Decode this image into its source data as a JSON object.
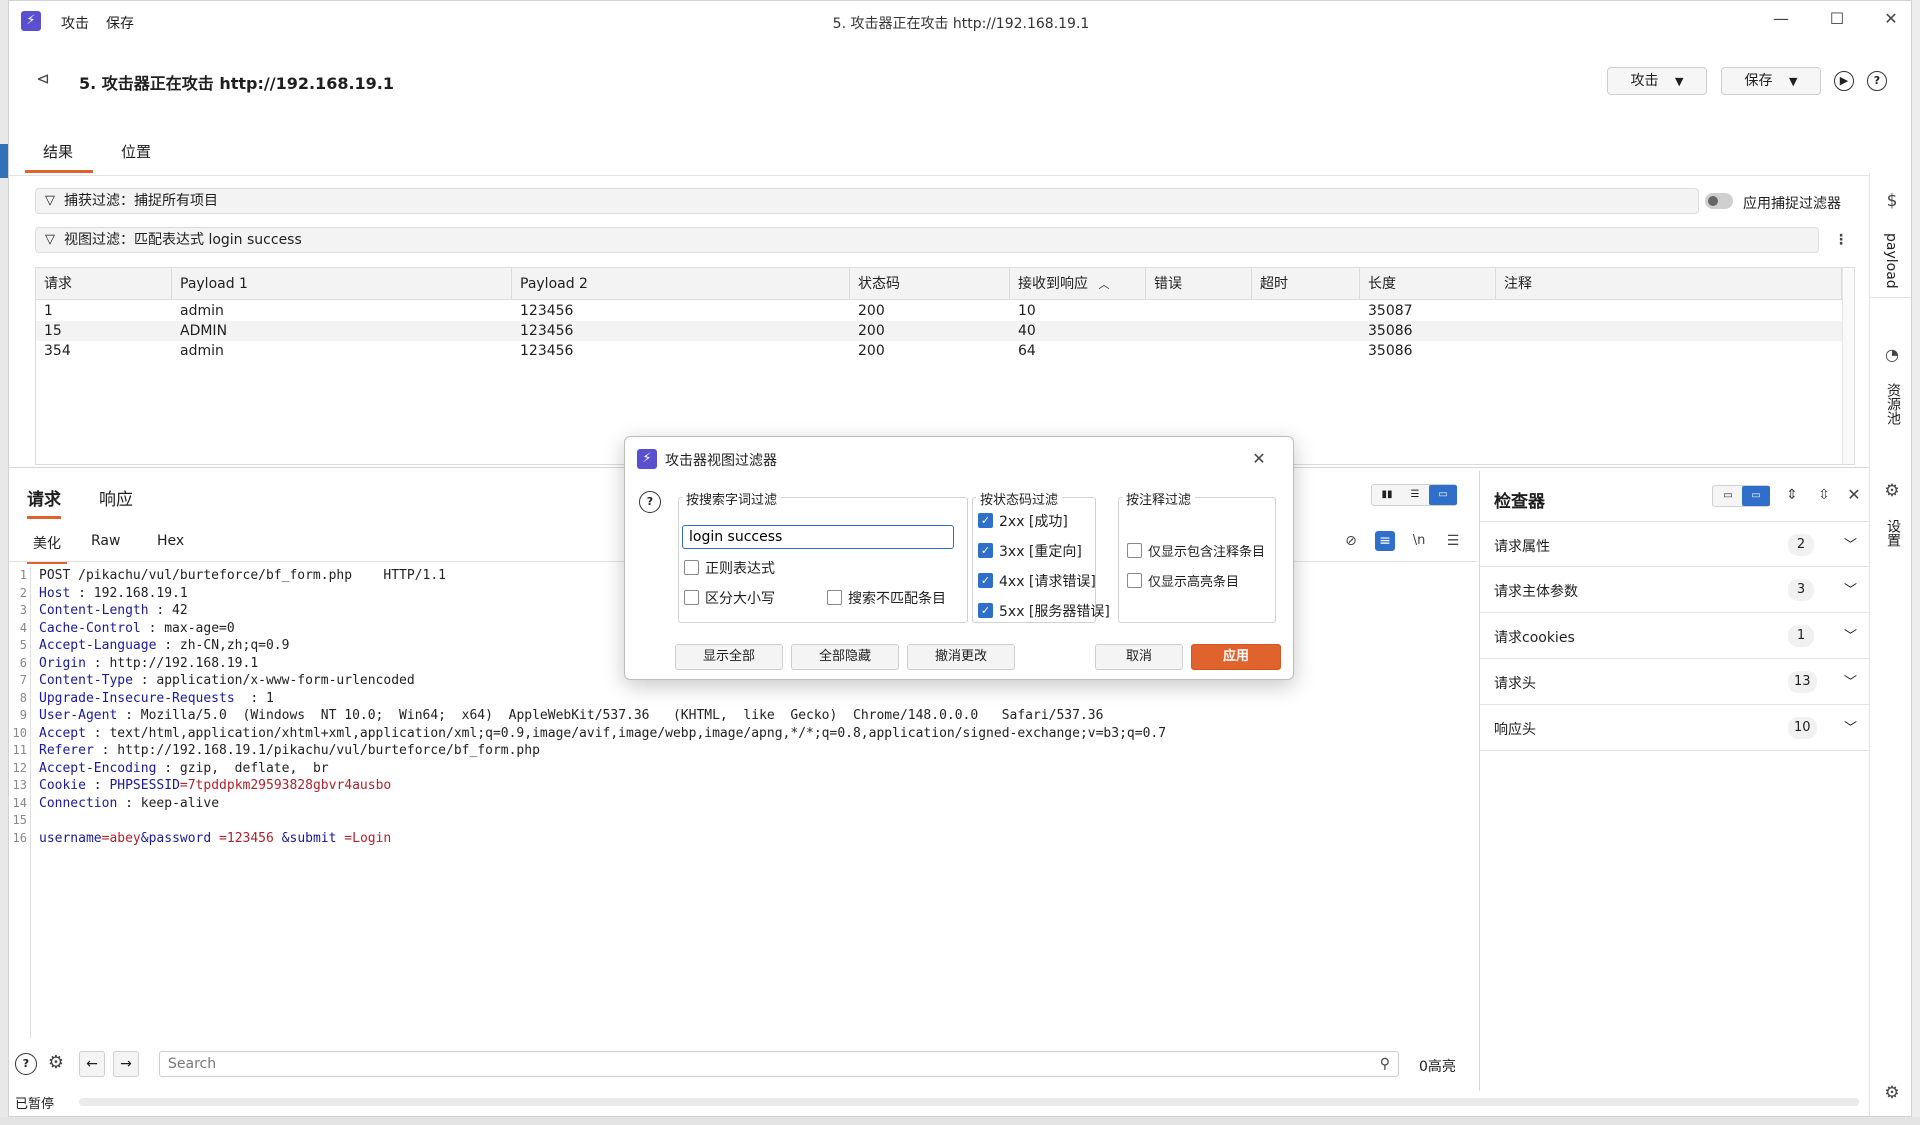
{
  "window": {
    "title": "5. 攻击器正在攻击 http://192.168.19.1",
    "menu": [
      "攻击",
      "保存"
    ]
  },
  "header": {
    "title": "5. 攻击器正在攻击 http://192.168.19.1",
    "attack_btn": "攻击",
    "save_btn": "保存"
  },
  "tabs": [
    "结果",
    "位置"
  ],
  "filters": {
    "capture": "捕获过滤：捕捉所有项目",
    "apply_capture": "应用捕捉过滤器",
    "view": "视图过滤：匹配表达式 login success"
  },
  "table": {
    "columns": [
      "请求",
      "Payload 1",
      "Payload 2",
      "状态码",
      "接收到响应",
      "错误",
      "超时",
      "长度",
      "注释"
    ],
    "rows": [
      [
        "1",
        "admin",
        "123456",
        "200",
        "10",
        "",
        "",
        "35087",
        ""
      ],
      [
        "15",
        "ADMIN",
        "123456",
        "200",
        "40",
        "",
        "",
        "35086",
        ""
      ],
      [
        "354",
        "admin",
        "123456",
        "200",
        "64",
        "",
        "",
        "35086",
        ""
      ]
    ]
  },
  "request_pane": {
    "tabs": [
      "请求",
      "响应"
    ],
    "subtabs": [
      "美化",
      "Raw",
      "Hex"
    ],
    "lines": [
      {
        "n": "1",
        "k": "",
        "v": "POST /pikachu/vul/burteforce/bf_form.php    HTTP/1.1"
      },
      {
        "n": "2",
        "k": "Host",
        "v": " : 192.168.19.1"
      },
      {
        "n": "3",
        "k": "Content-Length",
        "v": " : 42"
      },
      {
        "n": "4",
        "k": "Cache-Control",
        "v": " : max-age=0"
      },
      {
        "n": "5",
        "k": "Accept-Language",
        "v": " : zh-CN,zh;q=0.9"
      },
      {
        "n": "6",
        "k": "Origin",
        "v": " : http://192.168.19.1"
      },
      {
        "n": "7",
        "k": "Content-Type",
        "v": " : application/x-www-form-urlencoded"
      },
      {
        "n": "8",
        "k": "Upgrade-Insecure-Requests",
        "v": "  : 1"
      },
      {
        "n": "9",
        "k": "User-Agent",
        "v": " : Mozilla/5.0  (Windows  NT 10.0;  Win64;  x64)  AppleWebKit/537.36   (KHTML,  like  Gecko)  Chrome/148.0.0.0   Safari/537.36"
      },
      {
        "n": "10",
        "k": "Accept",
        "v": " : text/html,application/xhtml+xml,application/xml;q=0.9,image/avif,image/webp,image/apng,*/*;q=0.8,application/signed-exchange;v=b3;q=0.7"
      },
      {
        "n": "11",
        "k": "Referer",
        "v": " : http://192.168.19.1/pikachu/vul/burteforce/bf_form.php"
      },
      {
        "n": "12",
        "k": "Accept-Encoding",
        "v": " : gzip,  deflate,  br"
      },
      {
        "n": "13",
        "k": "Cookie",
        "v": " : ",
        "ck": "PHPSESSID",
        "cv": "=7tpddpkm29593828gbvr4ausbo"
      },
      {
        "n": "14",
        "k": "Connection",
        "v": " : keep-alive"
      },
      {
        "n": "15",
        "k": "",
        "v": ""
      },
      {
        "n": "16",
        "k": "",
        "v": ""
      }
    ],
    "body_line": {
      "k1": "username",
      "v1": "=abey",
      "k2": "&password",
      "v2": " =123456",
      "k3": " &submit",
      "v3": " =Login"
    },
    "search_placeholder": "Search",
    "highlight_count": "0高亮"
  },
  "inspector": {
    "title": "检查器",
    "rows": [
      {
        "label": "请求属性",
        "count": "2"
      },
      {
        "label": "请求主体参数",
        "count": "3"
      },
      {
        "label": "请求cookies",
        "count": "1"
      },
      {
        "label": "请求头",
        "count": "13"
      },
      {
        "label": "响应头",
        "count": "10"
      }
    ]
  },
  "rightbar": {
    "payload": "payload",
    "pool": "资源池",
    "settings": "设置"
  },
  "status": {
    "paused": "已暂停"
  },
  "dialog": {
    "title": "攻击器视图过滤器",
    "search_group": "按搜索字词过滤",
    "search_value": "login success",
    "regex": "正则表达式",
    "case": "区分大小写",
    "negative": "搜索不匹配条目",
    "status_group": "按状态码过滤",
    "status_items": [
      "2xx [成功]",
      "3xx [重定向]",
      "4xx [请求错误]",
      "5xx [服务器错误]"
    ],
    "note_group": "按注释过滤",
    "note_items": [
      "仅显示包含注释条目",
      "仅显示高亮条目"
    ],
    "btn_show_all": "显示全部",
    "btn_hide_all": "全部隐藏",
    "btn_revert": "撤消更改",
    "btn_cancel": "取消",
    "btn_apply": "应用"
  }
}
